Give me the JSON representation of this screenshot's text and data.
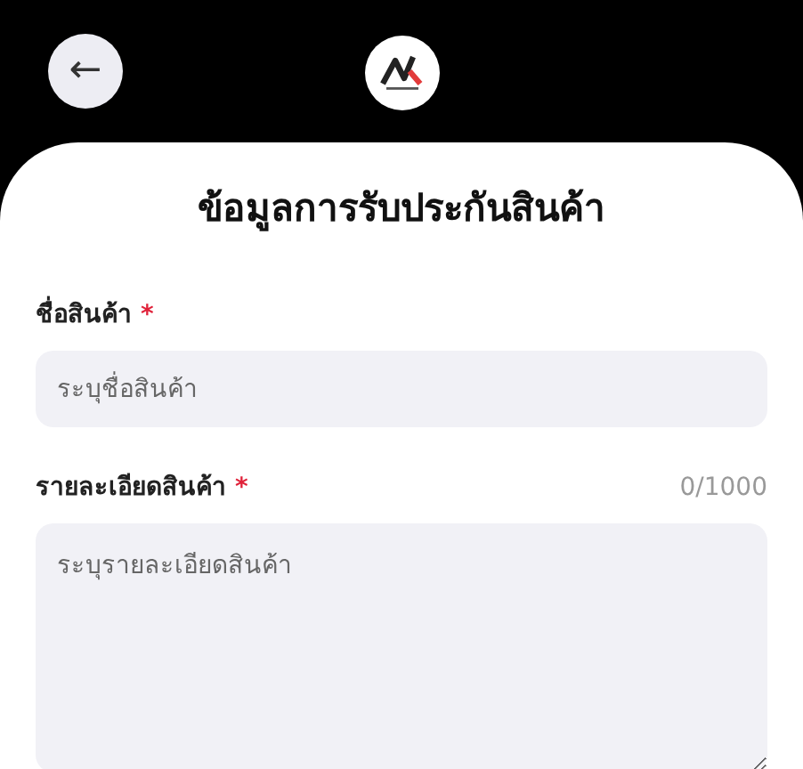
{
  "header": {
    "back_button": "←"
  },
  "title": "ข้อมูลการรับประกันสินค้า",
  "fields": [
    {
      "kind": "input",
      "label": "ชื่อสินค้า",
      "required_mark": "*",
      "placeholder": "ระบุชื่อสินค้า"
    },
    {
      "kind": "textarea",
      "label": "รายละเอียดสินค้า",
      "required_mark": "*",
      "counter": "0/1000",
      "placeholder": "ระบุรายละเอียดสินค้า"
    }
  ]
}
